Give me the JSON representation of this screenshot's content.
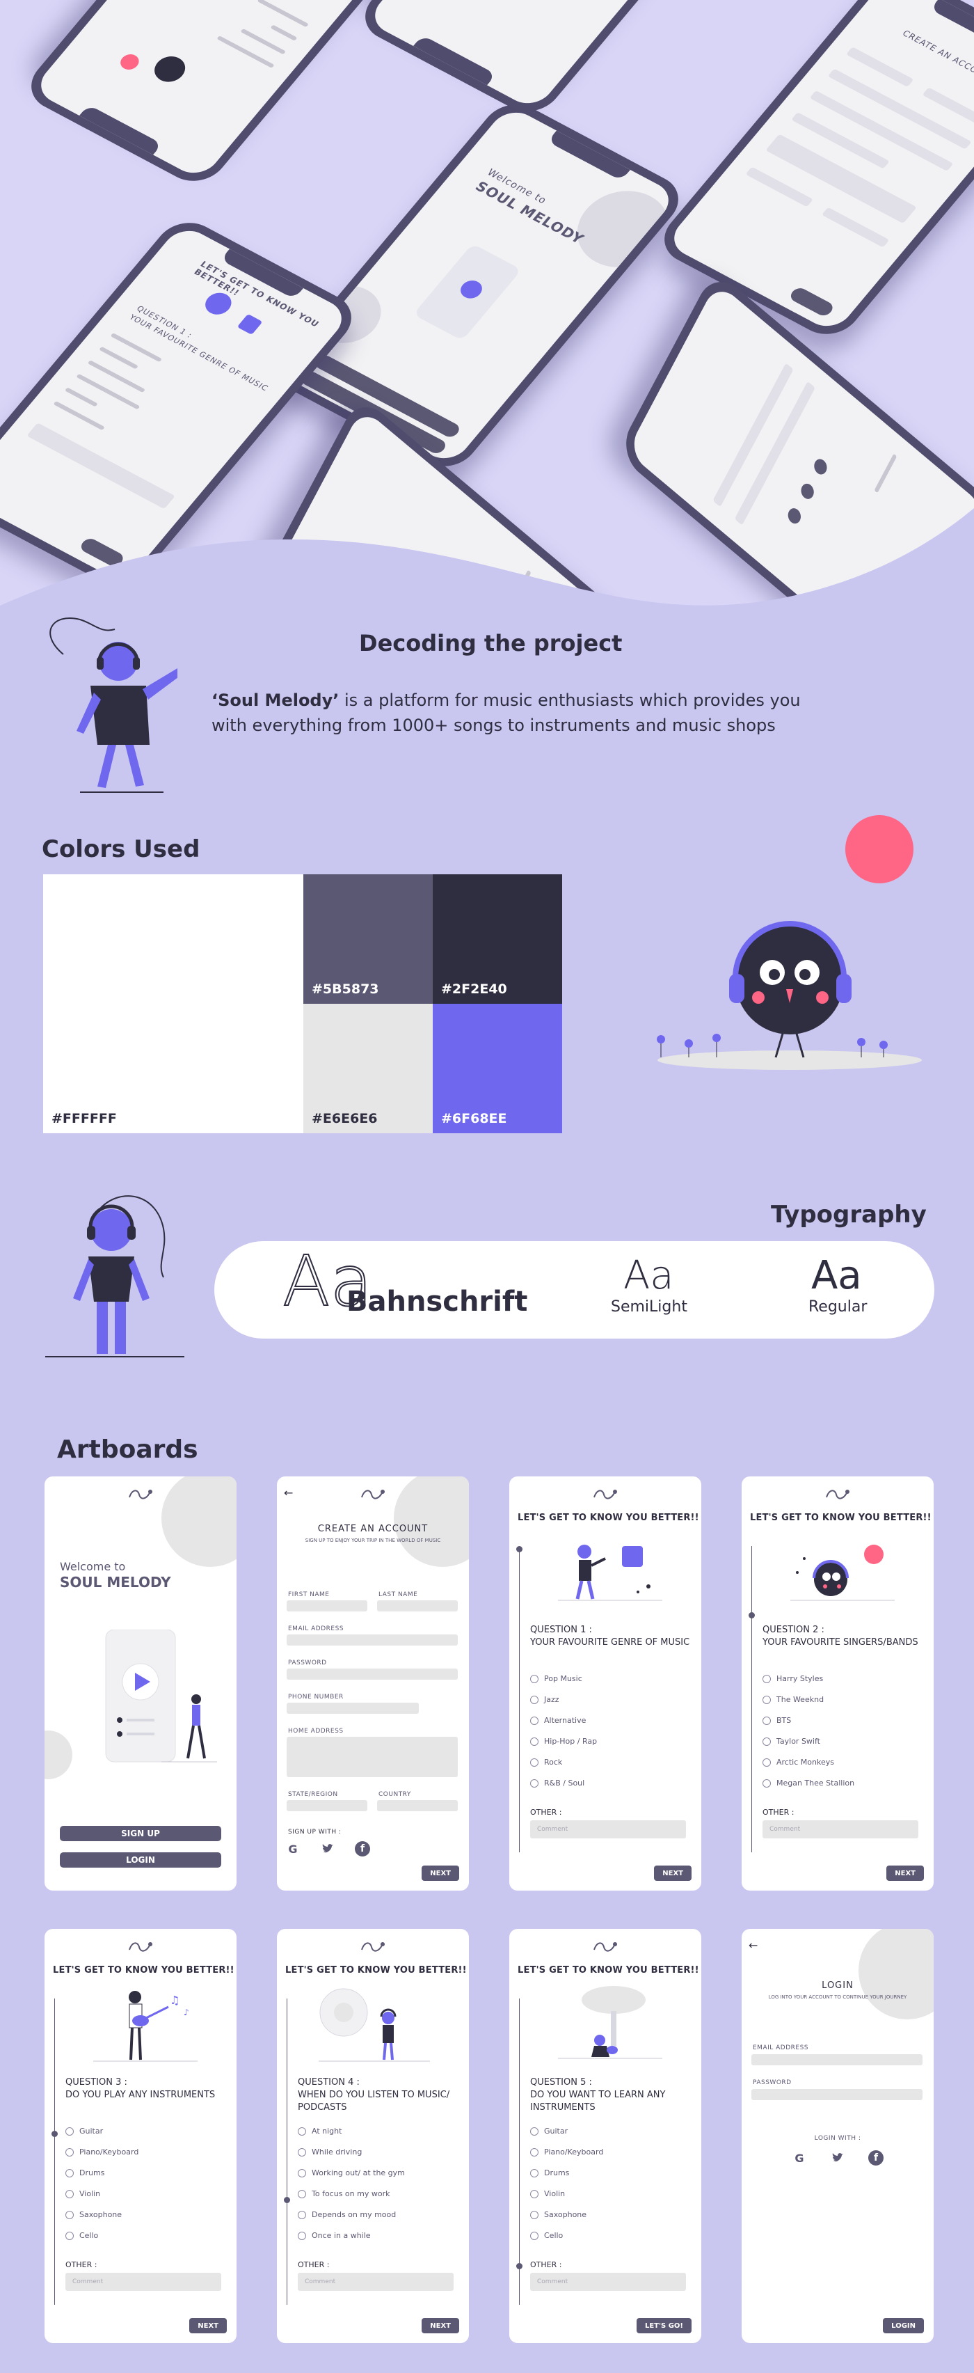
{
  "decoding": {
    "title": "Decoding the project",
    "brand": "‘Soul Melody’",
    "description": " is a platform for music enthusiasts which provides you with everything from 1000+ songs to instruments and music shops"
  },
  "colors": {
    "title": "Colors Used",
    "swatches": [
      {
        "hex": "#FFFFFF"
      },
      {
        "hex": "#5B5873"
      },
      {
        "hex": "#2F2E40"
      },
      {
        "hex": "#E6E6E6"
      },
      {
        "hex": "#6F68EE"
      }
    ],
    "accent_pink": "#FF6584"
  },
  "typography": {
    "title": "Typography",
    "sample_outline": "Aa",
    "font_name": "Bahnschrift",
    "samples": [
      {
        "glyph": "Aa",
        "label": "SemiLight"
      },
      {
        "glyph": "Aa",
        "label": "Regular"
      }
    ]
  },
  "hero": {
    "welcome": "Welcome to",
    "app_name": "SOUL MELODY",
    "sign_up": "SIGN UP",
    "login": "LOGIN",
    "create_account": "CREATE AN ACCOUNT",
    "get_to_know": "LET'S GET TO KNOW YOU BETTER!!",
    "question1": "QUESTION 1 :",
    "question1_text": "YOUR FAVOURITE GENRE OF MUSIC",
    "options": [
      "Pop Music",
      "Jazz",
      "Alternative",
      "Hip-Hop / Rap",
      "Rock",
      "R&B / Soul"
    ],
    "other": "OTHER :",
    "next": "NEXT"
  },
  "artboards": {
    "title": "Artboards",
    "welcome": {
      "welcome_to": "Welcome to",
      "app_name": "SOUL MELODY",
      "sign_up": "SIGN UP",
      "login": "LOGIN"
    },
    "signup": {
      "title": "CREATE AN ACCOUNT",
      "subtitle": "SIGN UP TO ENJOY YOUR TRIP IN THE WORLD OF MUSIC",
      "first_name": "FIRST NAME",
      "last_name": "LAST NAME",
      "email": "EMAIL ADDRESS",
      "password": "PASSWORD",
      "phone": "PHONE NUMBER",
      "home_address": "HOME ADDRESS",
      "state": "STATE/REGION",
      "country": "COUNTRY",
      "sign_up_with": "SIGN UP WITH :",
      "next": "NEXT"
    },
    "heading": "LET'S GET TO KNOW YOU BETTER!!",
    "other": "OTHER :",
    "other_placeholder": "Comment",
    "next": "NEXT",
    "q1": {
      "number": "QUESTION 1 :",
      "text": "YOUR FAVOURITE GENRE OF MUSIC",
      "options": [
        "Pop Music",
        "Jazz",
        "Alternative",
        "Hip-Hop / Rap",
        "Rock",
        "R&B / Soul"
      ]
    },
    "q2": {
      "number": "QUESTION 2 :",
      "text": "YOUR FAVOURITE SINGERS/BANDS",
      "options": [
        "Harry Styles",
        "The Weeknd",
        "BTS",
        "Taylor Swift",
        "Arctic Monkeys",
        "Megan Thee Stallion"
      ]
    },
    "q3": {
      "number": "QUESTION 3 :",
      "text": "DO YOU PLAY ANY INSTRUMENTS",
      "options": [
        "Guitar",
        "Piano/Keyboard",
        "Drums",
        "Violin",
        "Saxophone",
        "Cello"
      ]
    },
    "q4": {
      "number": "QUESTION 4 :",
      "text": "WHEN DO YOU LISTEN TO MUSIC/ PODCASTS",
      "options": [
        "At night",
        "While driving",
        "Working out/ at the gym",
        "To focus on my work",
        "Depends on my mood",
        "Once in a while"
      ]
    },
    "q5": {
      "number": "QUESTION 5 :",
      "text": "DO YOU WANT TO LEARN ANY INSTRUMENTS",
      "options": [
        "Guitar",
        "Piano/Keyboard",
        "Drums",
        "Violin",
        "Saxophone",
        "Cello"
      ],
      "button": "LET'S GO!"
    },
    "login": {
      "title": "LOGIN",
      "subtitle": "LOG INTO YOUR ACCOUNT TO CONTINUE YOUR JOURNEY",
      "email": "EMAIL ADDRESS",
      "password": "PASSWORD",
      "login_with": "LOGIN WITH :",
      "button": "LOGIN"
    }
  }
}
